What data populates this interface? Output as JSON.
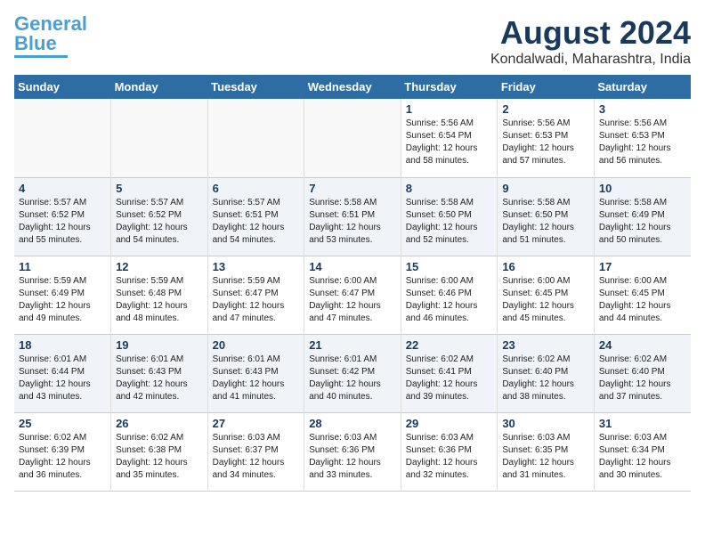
{
  "header": {
    "logo_line1": "General",
    "logo_line2": "Blue",
    "month_year": "August 2024",
    "location": "Kondalwadi, Maharashtra, India"
  },
  "weekdays": [
    "Sunday",
    "Monday",
    "Tuesday",
    "Wednesday",
    "Thursday",
    "Friday",
    "Saturday"
  ],
  "weeks": [
    [
      {
        "day": "",
        "content": ""
      },
      {
        "day": "",
        "content": ""
      },
      {
        "day": "",
        "content": ""
      },
      {
        "day": "",
        "content": ""
      },
      {
        "day": "1",
        "content": "Sunrise: 5:56 AM\nSunset: 6:54 PM\nDaylight: 12 hours\nand 58 minutes."
      },
      {
        "day": "2",
        "content": "Sunrise: 5:56 AM\nSunset: 6:53 PM\nDaylight: 12 hours\nand 57 minutes."
      },
      {
        "day": "3",
        "content": "Sunrise: 5:56 AM\nSunset: 6:53 PM\nDaylight: 12 hours\nand 56 minutes."
      }
    ],
    [
      {
        "day": "4",
        "content": "Sunrise: 5:57 AM\nSunset: 6:52 PM\nDaylight: 12 hours\nand 55 minutes."
      },
      {
        "day": "5",
        "content": "Sunrise: 5:57 AM\nSunset: 6:52 PM\nDaylight: 12 hours\nand 54 minutes."
      },
      {
        "day": "6",
        "content": "Sunrise: 5:57 AM\nSunset: 6:51 PM\nDaylight: 12 hours\nand 54 minutes."
      },
      {
        "day": "7",
        "content": "Sunrise: 5:58 AM\nSunset: 6:51 PM\nDaylight: 12 hours\nand 53 minutes."
      },
      {
        "day": "8",
        "content": "Sunrise: 5:58 AM\nSunset: 6:50 PM\nDaylight: 12 hours\nand 52 minutes."
      },
      {
        "day": "9",
        "content": "Sunrise: 5:58 AM\nSunset: 6:50 PM\nDaylight: 12 hours\nand 51 minutes."
      },
      {
        "day": "10",
        "content": "Sunrise: 5:58 AM\nSunset: 6:49 PM\nDaylight: 12 hours\nand 50 minutes."
      }
    ],
    [
      {
        "day": "11",
        "content": "Sunrise: 5:59 AM\nSunset: 6:49 PM\nDaylight: 12 hours\nand 49 minutes."
      },
      {
        "day": "12",
        "content": "Sunrise: 5:59 AM\nSunset: 6:48 PM\nDaylight: 12 hours\nand 48 minutes."
      },
      {
        "day": "13",
        "content": "Sunrise: 5:59 AM\nSunset: 6:47 PM\nDaylight: 12 hours\nand 47 minutes."
      },
      {
        "day": "14",
        "content": "Sunrise: 6:00 AM\nSunset: 6:47 PM\nDaylight: 12 hours\nand 47 minutes."
      },
      {
        "day": "15",
        "content": "Sunrise: 6:00 AM\nSunset: 6:46 PM\nDaylight: 12 hours\nand 46 minutes."
      },
      {
        "day": "16",
        "content": "Sunrise: 6:00 AM\nSunset: 6:45 PM\nDaylight: 12 hours\nand 45 minutes."
      },
      {
        "day": "17",
        "content": "Sunrise: 6:00 AM\nSunset: 6:45 PM\nDaylight: 12 hours\nand 44 minutes."
      }
    ],
    [
      {
        "day": "18",
        "content": "Sunrise: 6:01 AM\nSunset: 6:44 PM\nDaylight: 12 hours\nand 43 minutes."
      },
      {
        "day": "19",
        "content": "Sunrise: 6:01 AM\nSunset: 6:43 PM\nDaylight: 12 hours\nand 42 minutes."
      },
      {
        "day": "20",
        "content": "Sunrise: 6:01 AM\nSunset: 6:43 PM\nDaylight: 12 hours\nand 41 minutes."
      },
      {
        "day": "21",
        "content": "Sunrise: 6:01 AM\nSunset: 6:42 PM\nDaylight: 12 hours\nand 40 minutes."
      },
      {
        "day": "22",
        "content": "Sunrise: 6:02 AM\nSunset: 6:41 PM\nDaylight: 12 hours\nand 39 minutes."
      },
      {
        "day": "23",
        "content": "Sunrise: 6:02 AM\nSunset: 6:40 PM\nDaylight: 12 hours\nand 38 minutes."
      },
      {
        "day": "24",
        "content": "Sunrise: 6:02 AM\nSunset: 6:40 PM\nDaylight: 12 hours\nand 37 minutes."
      }
    ],
    [
      {
        "day": "25",
        "content": "Sunrise: 6:02 AM\nSunset: 6:39 PM\nDaylight: 12 hours\nand 36 minutes."
      },
      {
        "day": "26",
        "content": "Sunrise: 6:02 AM\nSunset: 6:38 PM\nDaylight: 12 hours\nand 35 minutes."
      },
      {
        "day": "27",
        "content": "Sunrise: 6:03 AM\nSunset: 6:37 PM\nDaylight: 12 hours\nand 34 minutes."
      },
      {
        "day": "28",
        "content": "Sunrise: 6:03 AM\nSunset: 6:36 PM\nDaylight: 12 hours\nand 33 minutes."
      },
      {
        "day": "29",
        "content": "Sunrise: 6:03 AM\nSunset: 6:36 PM\nDaylight: 12 hours\nand 32 minutes."
      },
      {
        "day": "30",
        "content": "Sunrise: 6:03 AM\nSunset: 6:35 PM\nDaylight: 12 hours\nand 31 minutes."
      },
      {
        "day": "31",
        "content": "Sunrise: 6:03 AM\nSunset: 6:34 PM\nDaylight: 12 hours\nand 30 minutes."
      }
    ]
  ]
}
